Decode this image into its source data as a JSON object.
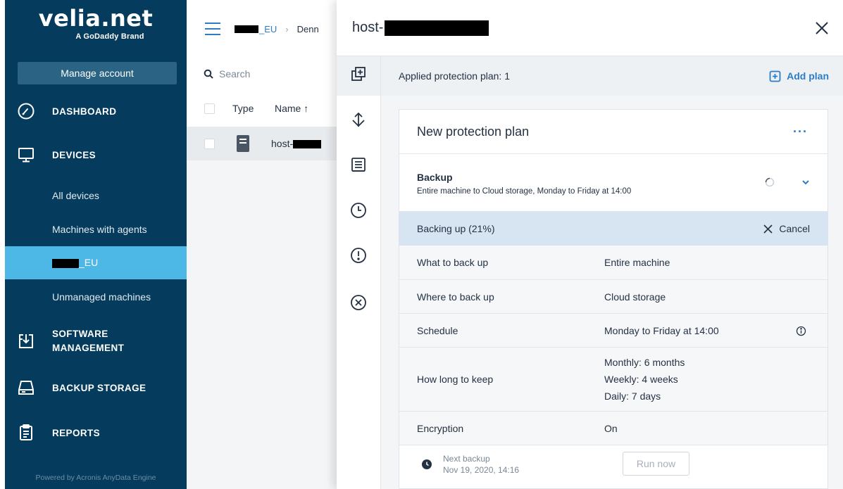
{
  "brand": {
    "logo_text": "velia.net",
    "tagline": "A GoDaddy Brand"
  },
  "sidebar": {
    "manage_account": "Manage account",
    "items": [
      {
        "label": "DASHBOARD",
        "icon": "dashboard-gauge-icon"
      },
      {
        "label": "DEVICES",
        "icon": "monitor-icon"
      },
      {
        "label": "SOFTWARE",
        "label2": "MANAGEMENT",
        "icon": "software-install-icon"
      },
      {
        "label": "BACKUP STORAGE",
        "icon": "storage-drive-icon"
      },
      {
        "label": "REPORTS",
        "icon": "clipboard-report-icon"
      }
    ],
    "sub_items": [
      {
        "label": "All devices"
      },
      {
        "label": "Machines with agents"
      },
      {
        "label": "_EU",
        "active": true
      },
      {
        "label": "Unmanaged machines"
      }
    ],
    "powered_by": "Powered by Acronis AnyData Engine",
    "active_color": "#4db7e6",
    "bg_color": "#053b5c"
  },
  "list_pane": {
    "breadcrumb": [
      "_EU",
      "Denn"
    ],
    "search_placeholder": "Search",
    "columns": [
      "Type",
      "Name ↑"
    ],
    "rows": [
      {
        "name": "host-"
      }
    ]
  },
  "panel": {
    "title": "host-",
    "applied_label": "Applied protection plan: 1",
    "add_plan_label": "Add plan",
    "plan": {
      "name": "New protection plan",
      "more_label": "···",
      "backup_title": "Backup",
      "backup_desc": "Entire machine to Cloud storage, Monday to Friday at 14:00",
      "progress_label": "Backing up (21%)",
      "progress_percent": 21,
      "cancel_label": "Cancel",
      "details": [
        {
          "key": "What to back up",
          "values": [
            "Entire machine"
          ]
        },
        {
          "key": "Where to back up",
          "values": [
            "Cloud storage"
          ]
        },
        {
          "key": "Schedule",
          "values": [
            "Monday to Friday at 14:00"
          ]
        },
        {
          "key": "How long to keep",
          "values": [
            "Monthly: 6 months",
            "Weekly: 4 weeks",
            "Daily: 7 days"
          ]
        },
        {
          "key": "Encryption",
          "values": [
            "On"
          ]
        }
      ],
      "next_backup_label": "Next backup",
      "next_backup_time": "Nov 19, 2020, 14:16",
      "run_now_label": "Run now"
    },
    "accent_color": "#2c7cc6"
  }
}
